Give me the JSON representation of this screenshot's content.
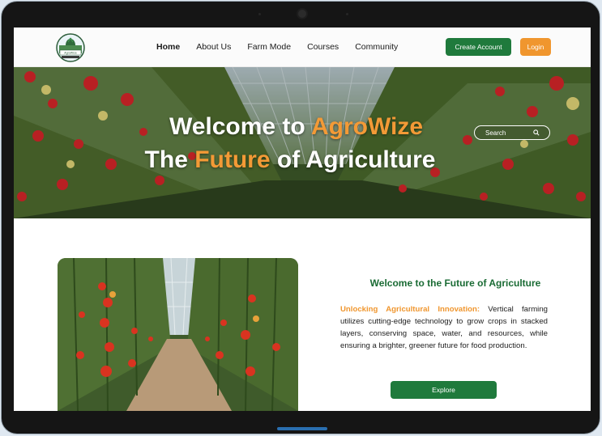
{
  "nav": {
    "links": [
      "Home",
      "About Us",
      "Farm Mode",
      "Courses",
      "Community"
    ],
    "active": "Home",
    "create_account": "Create Account",
    "login": "Login",
    "logo_text": "AgroWize"
  },
  "hero": {
    "line1_prefix": "Welcome to ",
    "line1_accent": "AgroWize",
    "line2_prefix": "The ",
    "line2_accent": "Future",
    "line2_suffix": " of Agriculture",
    "search_placeholder": "Search"
  },
  "content": {
    "title": "Welcome to the Future of Agriculture",
    "highlight": "Unlocking Agricultural Innovation:",
    "body": " Vertical farming utilizes cutting-edge technology to grow crops in stacked layers, conserving space, water, and resources, while ensuring a brighter, greener future for food production.",
    "explore": "Explore"
  },
  "colors": {
    "brand_green": "#1f7a3c",
    "accent_orange": "#f0962e"
  }
}
